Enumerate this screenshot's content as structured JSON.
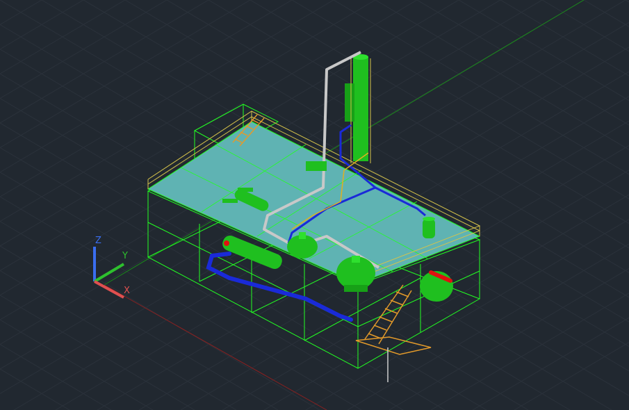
{
  "viewport": {
    "background": "#212830",
    "grid_color": "#2b323b",
    "model_colors": {
      "frame": "#22ff22",
      "deck": "#5fb3b3",
      "railing": "#d6c34a",
      "stairs": "#e39a2a",
      "equipment": "#1fbf1f",
      "pipe_silver": "#c8c8c8",
      "pipe_blue": "#1a2ad8",
      "pipe_yellow": "#e0b020",
      "vessel_red": "#e01010"
    },
    "world_axes": {
      "x_color": "#a82020",
      "y_color": "#1a8a1a"
    }
  },
  "ucs_icon": {
    "x_label": "X",
    "y_label": "Y",
    "z_label": "Z",
    "x_color": "#e05050",
    "y_color": "#2ec02e",
    "z_color": "#3a6ef0"
  }
}
